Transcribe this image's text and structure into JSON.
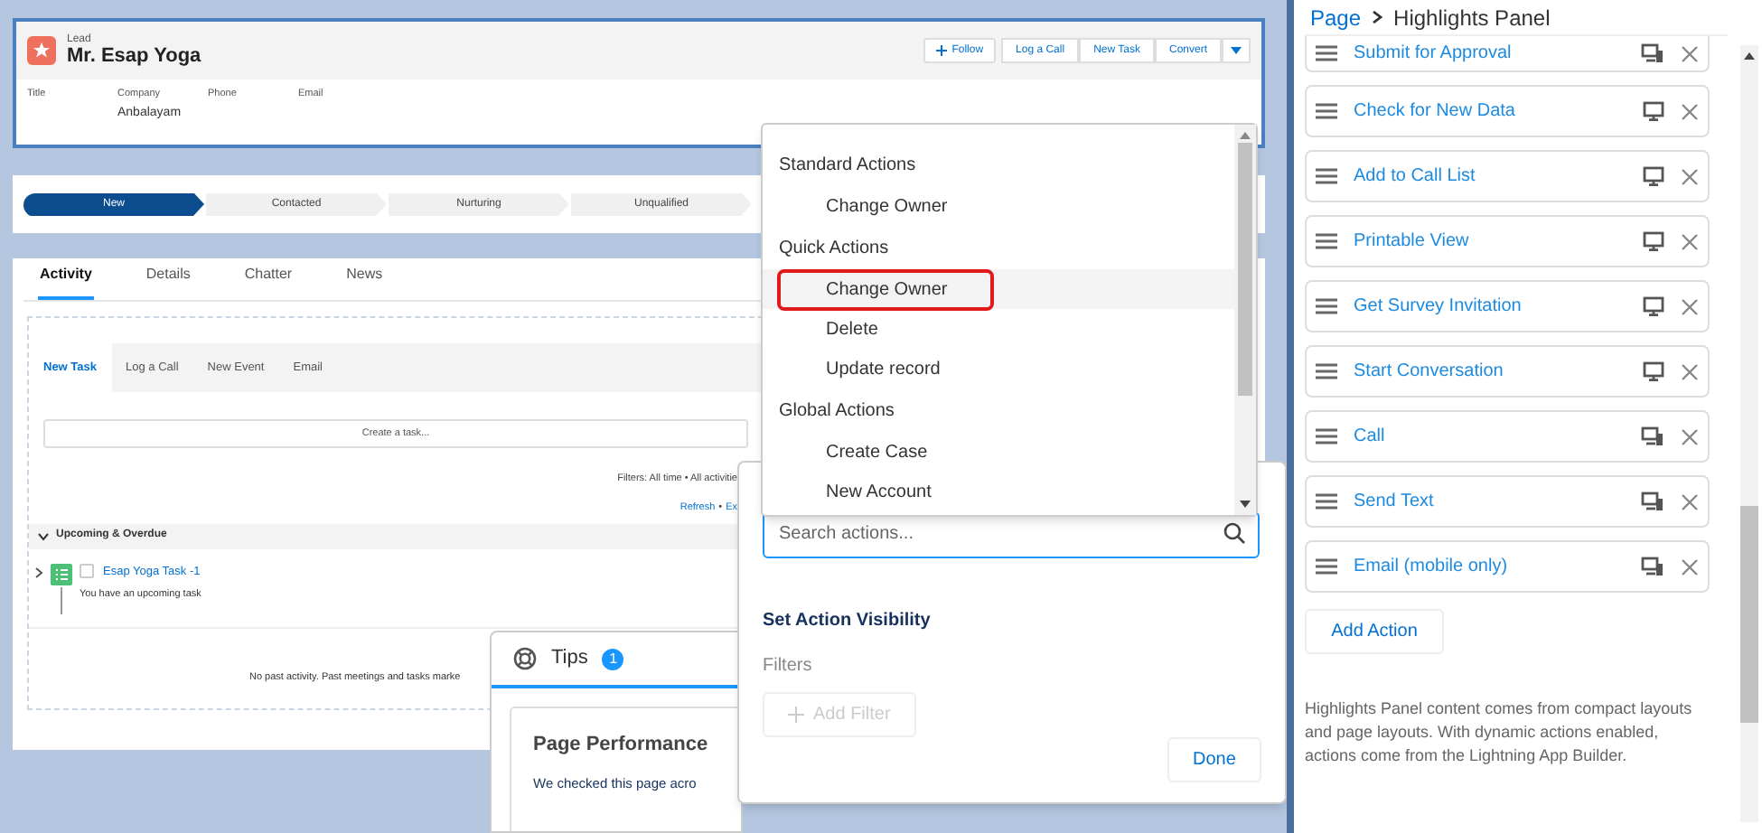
{
  "record": {
    "object": "Lead",
    "name": "Mr. Esap Yoga",
    "follow_button": "Follow",
    "actions": [
      "Log a Call",
      "New Task",
      "Convert"
    ],
    "fields": [
      {
        "label": "Title"
      },
      {
        "label": "Company",
        "value": "Anbalayam"
      },
      {
        "label": "Phone"
      },
      {
        "label": "Email"
      }
    ]
  },
  "path": [
    {
      "label": "New",
      "selected": true
    },
    {
      "label": "Contacted",
      "selected": false
    },
    {
      "label": "Nurturing",
      "selected": false
    },
    {
      "label": "Unqualified",
      "selected": false
    }
  ],
  "tabs": [
    {
      "label": "Activity",
      "selected": true
    },
    {
      "label": "Details",
      "selected": false
    },
    {
      "label": "Chatter",
      "selected": false
    },
    {
      "label": "News",
      "selected": false
    }
  ],
  "subtabs": [
    {
      "label": "New Task",
      "selected": true
    },
    {
      "label": "Log a Call",
      "selected": false
    },
    {
      "label": "New Event",
      "selected": false
    },
    {
      "label": "Email",
      "selected": false
    }
  ],
  "composer_button": "Create a task...",
  "filters_text": "Filters: All time • All activitie",
  "refresh_links": [
    "Refresh",
    "Ex"
  ],
  "refresh_separator": "•",
  "section": {
    "title": "Upcoming & Overdue",
    "expanded": true
  },
  "task": {
    "title": "Esap Yoga Task -1",
    "subtitle": "You have an upcoming task",
    "checked": false,
    "expanded": false
  },
  "empty_text": "No past activity. Past meetings and tasks marke",
  "tips": {
    "title": "Tips",
    "count": "1",
    "card_title": "Page Performance",
    "card_text": "We checked this page acro"
  },
  "actions_menu": {
    "groups": [
      {
        "title": "Standard Actions",
        "items": [
          {
            "label": "Change Owner",
            "selected": false
          }
        ]
      },
      {
        "title": "Quick Actions",
        "items": [
          {
            "label": "Change Owner",
            "selected": true
          },
          {
            "label": "Delete",
            "selected": false
          },
          {
            "label": "Update record",
            "selected": false
          }
        ]
      },
      {
        "title": "Global Actions",
        "items": [
          {
            "label": "Create Case",
            "selected": false
          },
          {
            "label": "New Account",
            "selected": false
          }
        ]
      }
    ]
  },
  "popover": {
    "search": {
      "placeholder": "Search actions..."
    },
    "heading": "Set Action Visibility",
    "filters_label": "Filters",
    "add_filter": {
      "label": "Add Filter",
      "disabled": true
    },
    "done": "Done"
  },
  "panel": {
    "breadcrumb": [
      "Page",
      "Highlights Panel"
    ],
    "actions": [
      {
        "label": "Submit for Approval",
        "kind": "both"
      },
      {
        "label": "Check for New Data",
        "kind": "desktop"
      },
      {
        "label": "Add to Call List",
        "kind": "desktop"
      },
      {
        "label": "Printable View",
        "kind": "desktop"
      },
      {
        "label": "Get Survey Invitation",
        "kind": "desktop"
      },
      {
        "label": "Start Conversation",
        "kind": "desktop"
      },
      {
        "label": "Call",
        "kind": "both"
      },
      {
        "label": "Send Text",
        "kind": "both"
      },
      {
        "label": "Email (mobile only)",
        "kind": "both"
      }
    ],
    "add_action": "Add Action",
    "description": "Highlights Panel content comes from compact layouts and page layouts. With dynamic actions enabled, actions come from the Lightning App Builder."
  }
}
